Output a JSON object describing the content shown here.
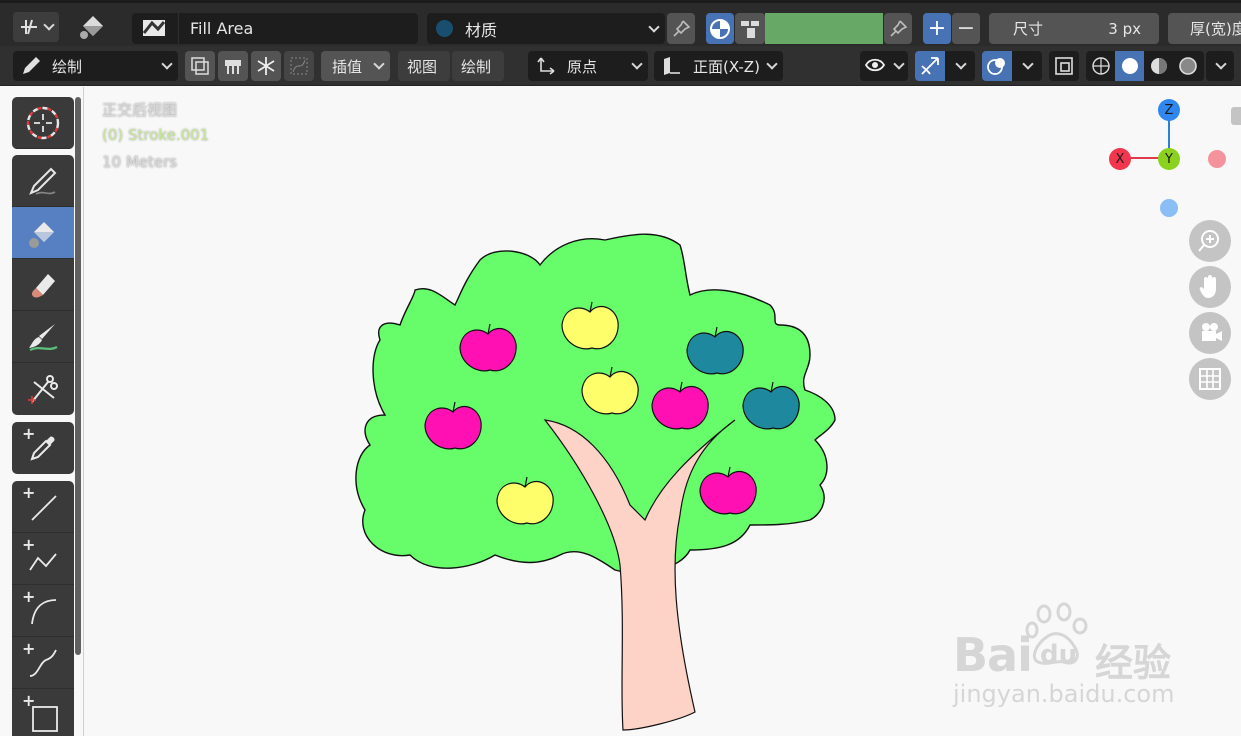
{
  "header": {
    "fill_area_label": "Fill Area",
    "material_label": "材质",
    "size_label": "尺寸",
    "size_value": "3 px",
    "thickness_label": "厚(宽)度",
    "material_color": "#1a4e6e",
    "fill_color": "#67a866"
  },
  "toolbar": {
    "mode_label": "绘制",
    "interpolate_label": "插值",
    "view_label": "视图",
    "draw_label": "绘制",
    "origin_label": "原点",
    "front_view_label": "正面(X-Z)"
  },
  "viewport": {
    "view_name": "正交后视图",
    "object_name": "(0) Stroke.001",
    "scale_label": "10 Meters"
  },
  "gizmo": {
    "z_label": "Z",
    "y_label": "Y",
    "x_label": "X"
  },
  "watermark": {
    "logo_text": "Bai",
    "du_text": "du",
    "jingyan_text": "经验",
    "url_text": "jingyan.baidu.com"
  }
}
